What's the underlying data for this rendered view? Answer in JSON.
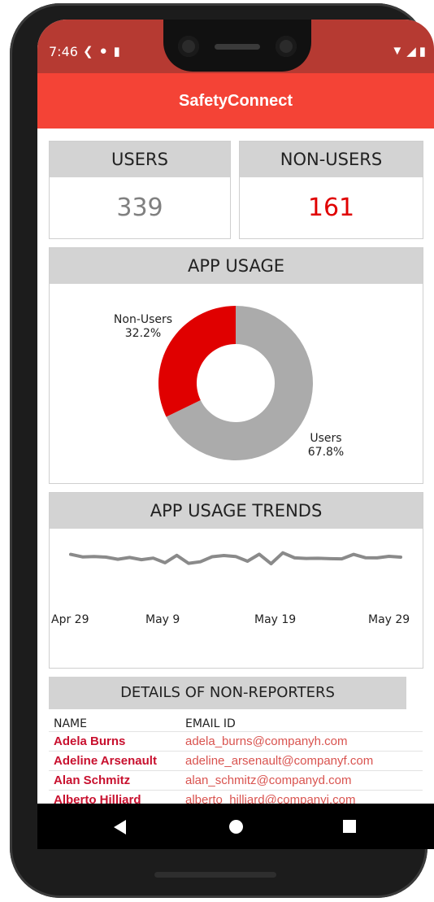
{
  "status_bar": {
    "time": "7:46",
    "left_icons": [
      "back-arrow-icon",
      "circle-p-icon",
      "sd-card-icon"
    ],
    "right_icons": [
      "wifi-icon",
      "signal-icon",
      "battery-icon"
    ]
  },
  "app": {
    "title": "SafetyConnect",
    "accent_color": "#f44336"
  },
  "users_card": {
    "label": "USERS",
    "value": "339"
  },
  "nonusers_card": {
    "label": "NON-USERS",
    "value": "161",
    "value_color": "#e00000"
  },
  "usage_card": {
    "title": "APP USAGE",
    "nonusers_label": "Non-Users",
    "nonusers_pct": "32.2%",
    "users_label": "Users",
    "users_pct": "67.8%"
  },
  "trends_card": {
    "title": "APP USAGE TRENDS"
  },
  "chart_data": [
    {
      "type": "pie",
      "title": "APP USAGE",
      "donut": true,
      "slices": [
        {
          "label": "Users",
          "value": 67.8,
          "color": "#ababab"
        },
        {
          "label": "Non-Users",
          "value": 32.2,
          "color": "#e00000"
        }
      ]
    },
    {
      "type": "line",
      "title": "APP USAGE TRENDS",
      "x_ticks": [
        "Apr 29",
        "May 9",
        "May 19",
        "May 29"
      ],
      "y_ticks": [],
      "grid": false,
      "series": [
        {
          "color": "#8a8a8a",
          "values": [
            11.5,
            10.2,
            10.4,
            10.1,
            9.0,
            9.9,
            8.8,
            9.6,
            7.2,
            11.0,
            6.9,
            7.7,
            10.3,
            10.9,
            10.4,
            8.0,
            11.6,
            6.7,
            12.3,
            9.7,
            9.4,
            9.5,
            9.3,
            9.2,
            11.5,
            9.8,
            9.7,
            10.5,
            10.1
          ]
        }
      ]
    }
  ],
  "details": {
    "title": "DETAILS OF NON-REPORTERS",
    "col_name": "NAME",
    "col_email": "EMAIL ID",
    "rows": [
      {
        "name": "Adela Burns",
        "email": "adela_burns@companyh.com"
      },
      {
        "name": "Adeline Arsenault",
        "email": "adeline_arsenault@companyf.com"
      },
      {
        "name": "Alan Schmitz",
        "email": "alan_schmitz@companyd.com"
      },
      {
        "name": "Alberto Hilliard",
        "email": "alberto_hilliard@companyi.com"
      }
    ]
  },
  "nav": {
    "back_icon": "triangle-back-icon",
    "home_icon": "circle-home-icon",
    "recent_icon": "square-recent-icon"
  }
}
